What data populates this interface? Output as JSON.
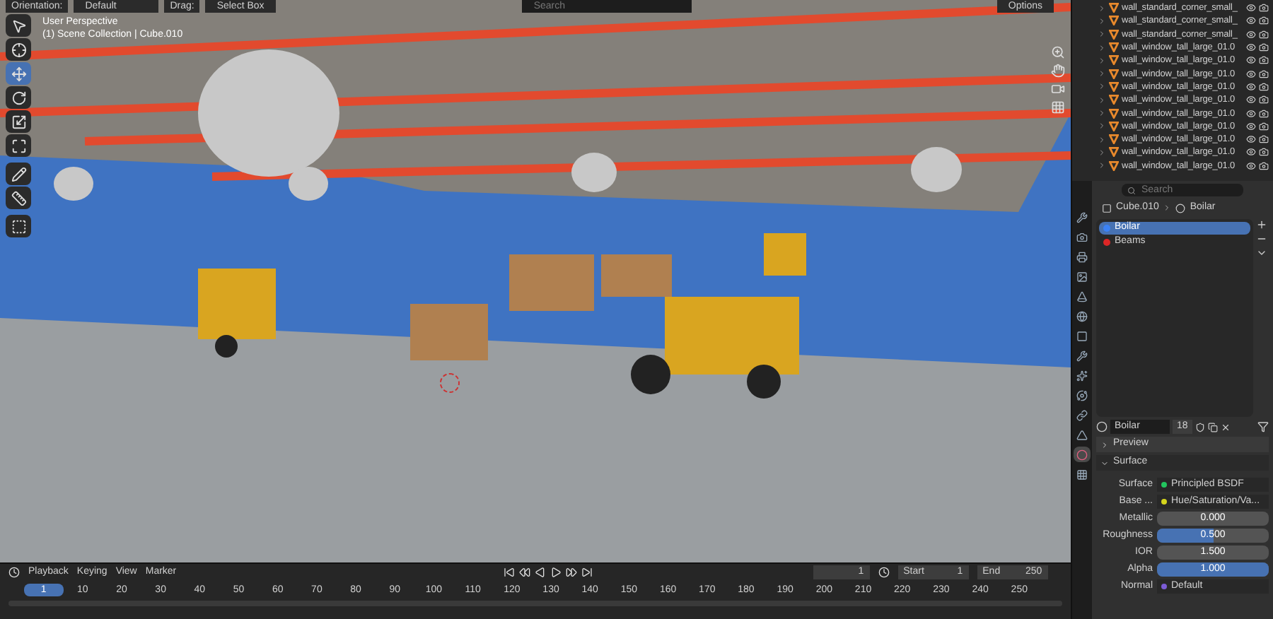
{
  "header": {
    "orientation_label": "Orientation:",
    "orientation_value": "Default",
    "drag_label": "Drag:",
    "drag_value": "Select Box",
    "search_placeholder": "Search",
    "options": "Options"
  },
  "viewport": {
    "overlay_lines": [
      "User Perspective",
      "(1) Scene Collection | Cube.010"
    ],
    "tools": [
      {
        "kind": "select",
        "selected": false
      },
      {
        "kind": "cursor",
        "selected": false
      },
      {
        "kind": "move",
        "selected": true
      },
      {
        "kind": "rotate",
        "selected": false
      },
      {
        "kind": "scale",
        "selected": false
      },
      {
        "kind": "transform",
        "selected": false
      },
      {
        "kind": "annotate",
        "selected": false
      },
      {
        "kind": "measure",
        "selected": false
      },
      {
        "kind": "add_cube",
        "selected": false
      }
    ]
  },
  "outliner": {
    "rows": [
      {
        "name": "wall_standard_corner_small_"
      },
      {
        "name": "wall_standard_corner_small_"
      },
      {
        "name": "wall_standard_corner_small_"
      },
      {
        "name": "wall_window_tall_large_01.0"
      },
      {
        "name": "wall_window_tall_large_01.0"
      },
      {
        "name": "wall_window_tall_large_01.0"
      },
      {
        "name": "wall_window_tall_large_01.0"
      },
      {
        "name": "wall_window_tall_large_01.0"
      },
      {
        "name": "wall_window_tall_large_01.0"
      },
      {
        "name": "wall_window_tall_large_01.0"
      },
      {
        "name": "wall_window_tall_large_01.0"
      },
      {
        "name": "wall_window_tall_large_01.0"
      },
      {
        "name": "wall_window_tall_large_01.0"
      }
    ]
  },
  "properties": {
    "search_placeholder": "Search",
    "breadcrumb": [
      "Cube.010",
      "Boilar"
    ],
    "tabs": [
      {
        "kind": "tool",
        "selected": false
      },
      {
        "kind": "render",
        "selected": false
      },
      {
        "kind": "output",
        "selected": false
      },
      {
        "kind": "view_layer",
        "selected": false
      },
      {
        "kind": "scene",
        "selected": false
      },
      {
        "kind": "world",
        "selected": false
      },
      {
        "kind": "object",
        "selected": false
      },
      {
        "kind": "modifiers",
        "selected": false
      },
      {
        "kind": "particles",
        "selected": false
      },
      {
        "kind": "physics",
        "selected": false
      },
      {
        "kind": "constraints",
        "selected": false
      },
      {
        "kind": "data",
        "selected": false
      },
      {
        "kind": "material",
        "selected": true
      },
      {
        "kind": "texture",
        "selected": false
      }
    ],
    "slots": [
      {
        "name": "Boilar",
        "selected": true,
        "color": "#3b82f6"
      },
      {
        "name": "Beams",
        "selected": false,
        "color": "#dc2626"
      }
    ],
    "material": {
      "name": "Boilar",
      "users": "18"
    },
    "panels": [
      {
        "label": "Preview",
        "expanded": false
      },
      {
        "label": "Surface",
        "expanded": true
      }
    ],
    "fields": [
      {
        "kind": "link",
        "label": "Surface",
        "value": "Principled BSDF",
        "color": "#22c55e"
      },
      {
        "kind": "link",
        "label": "Base ...",
        "value": "Hue/Saturation/Va...",
        "color": "#d4d41c"
      },
      {
        "kind": "number",
        "label": "Metallic",
        "value": "0.000"
      },
      {
        "kind": "slider",
        "label": "Roughness",
        "value": "0.500",
        "level": 0.5
      },
      {
        "kind": "number",
        "label": "IOR",
        "value": "1.500"
      },
      {
        "kind": "slider",
        "label": "Alpha",
        "value": "1.000",
        "level": 1
      },
      {
        "kind": "link",
        "label": "Normal",
        "value": "Default",
        "color": "#7c5cd6"
      }
    ]
  },
  "timeline": {
    "menus": [
      "Playback",
      "Keying",
      "View",
      "Marker"
    ],
    "current": "1",
    "start_label": "Start",
    "start": "1",
    "end_label": "End",
    "end": "250",
    "ticks": [
      {
        "label": "1",
        "selected": true
      },
      {
        "label": "10",
        "selected": false
      },
      {
        "label": "20",
        "selected": false
      },
      {
        "label": "30",
        "selected": false
      },
      {
        "label": "40",
        "selected": false
      },
      {
        "label": "50",
        "selected": false
      },
      {
        "label": "60",
        "selected": false
      },
      {
        "label": "70",
        "selected": false
      },
      {
        "label": "80",
        "selected": false
      },
      {
        "label": "90",
        "selected": false
      },
      {
        "label": "100",
        "selected": false
      },
      {
        "label": "110",
        "selected": false
      },
      {
        "label": "120",
        "selected": false
      },
      {
        "label": "130",
        "selected": false
      },
      {
        "label": "140",
        "selected": false
      },
      {
        "label": "150",
        "selected": false
      },
      {
        "label": "160",
        "selected": false
      },
      {
        "label": "170",
        "selected": false
      },
      {
        "label": "180",
        "selected": false
      },
      {
        "label": "190",
        "selected": false
      },
      {
        "label": "200",
        "selected": false
      },
      {
        "label": "210",
        "selected": false
      },
      {
        "label": "220",
        "selected": false
      },
      {
        "label": "230",
        "selected": false
      },
      {
        "label": "240",
        "selected": false
      },
      {
        "label": "250",
        "selected": false
      }
    ]
  }
}
